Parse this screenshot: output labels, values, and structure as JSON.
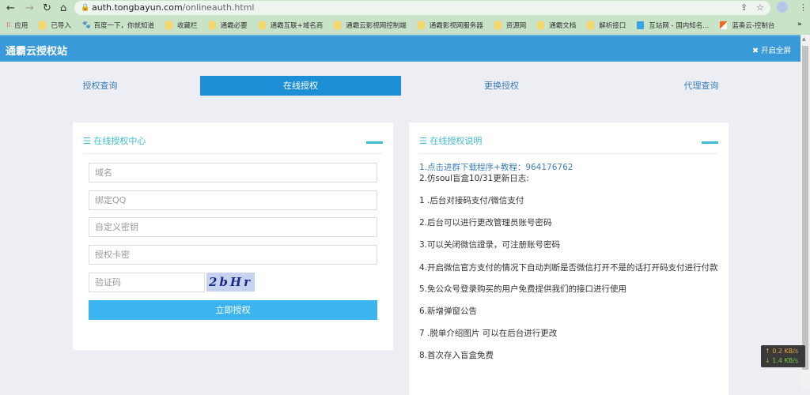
{
  "browser": {
    "url_host": "auth.tongbayun.com",
    "url_path": "/onlineauth.html",
    "bookmarks": [
      "应用",
      "已导入",
      "百度一下，你就知道",
      "收藏栏",
      "通霸必要",
      "通霸互联+域名商",
      "通霸云影视网控制端",
      "通霸影视网服务器",
      "资源网",
      "通霸文档",
      "解析接口",
      "互站网 - 国内知名...",
      "蓝奏云-控制台"
    ],
    "more": "»"
  },
  "header": {
    "title": "通霸云授权站",
    "fullscreen": "开启全屏"
  },
  "tabs": [
    "授权查询",
    "在线授权",
    "更换授权",
    "代理查询"
  ],
  "left": {
    "title": "在线授权中心",
    "placeholders": [
      "域名",
      "绑定QQ",
      "自定义密钥",
      "授权卡密",
      "验证码"
    ],
    "captcha": "2bHr",
    "submit": "立即授权"
  },
  "right": {
    "title": "在线授权说明",
    "link": "1.点击进群下载程序+教程：964176762",
    "lines": [
      "2.仿soul盲盒10/31更新日志:",
      "1 .后台对接码支付/微信支付",
      "2.后台可以进行更改管理员账号密码",
      "3.可以关闭微信證录，可注册账号密码",
      "4.开启微信官方支付的情况下自动判断是否微信打开不是的话打开码支付进行付款",
      "5.免公众号登录购买的用户免费提供我们的接口进行使用",
      "6.新增弹窗公告",
      "7 .脱单介绍图片 可以在后台进行更改",
      "8.首次存入盲盒免费"
    ]
  },
  "net": {
    "up": "↑ 0.2 KB/s",
    "down": "↓ 1.4 KB/s"
  }
}
